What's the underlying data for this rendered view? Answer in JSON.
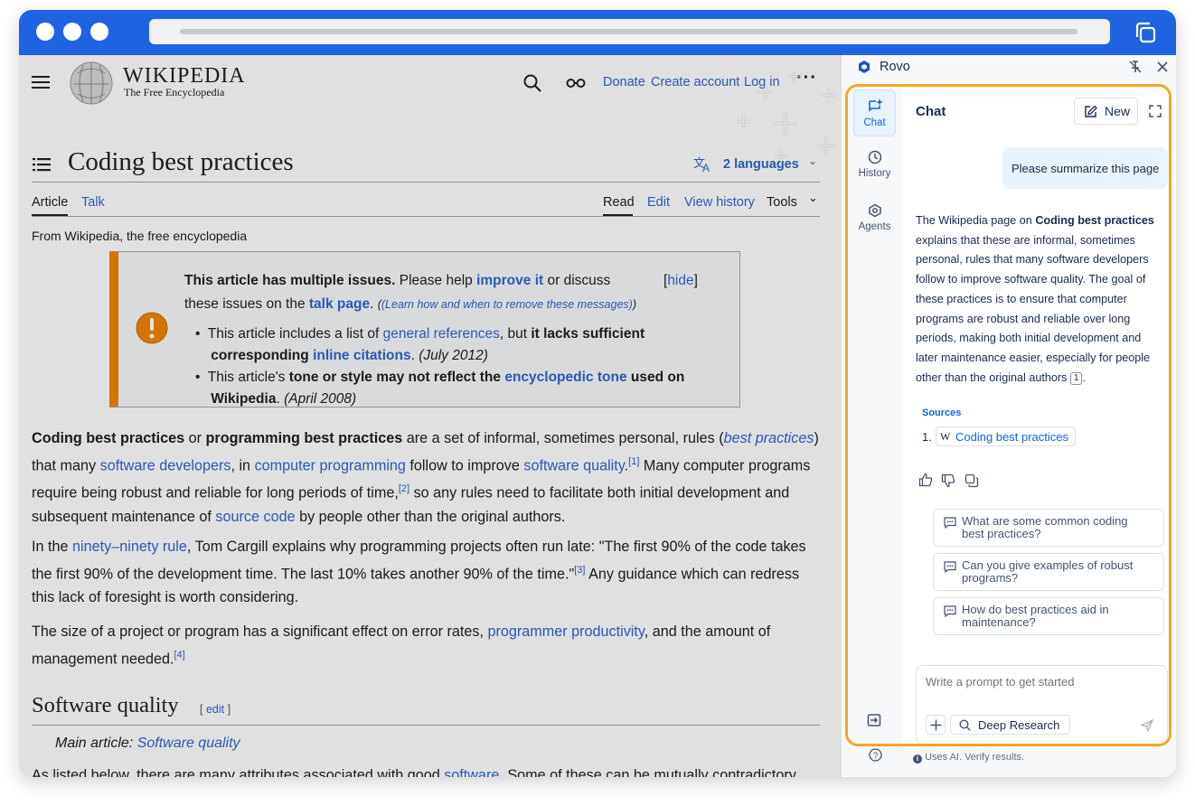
{
  "wiki": {
    "logo_title": "WIKIPEDIA",
    "logo_subtitle": "The Free Encyclopedia",
    "nav": {
      "donate": "Donate",
      "create_account": "Create account",
      "log_in": "Log in"
    },
    "page_title": "Coding best practices",
    "languages": "2 languages",
    "tabs": {
      "article": "Article",
      "talk": "Talk",
      "read": "Read",
      "edit": "Edit",
      "view_history": "View history",
      "tools": "Tools"
    },
    "tagline": "From Wikipedia, the free encyclopedia",
    "notice": {
      "hide": "hide",
      "line1_bold": "This article has multiple issues.",
      "line1_text": "Please help",
      "line1_link": "improve it",
      "line1_tail": "or discuss",
      "line2_text": "these issues on the",
      "line2_link": "talk page",
      "line2_small": "(Learn how and when to remove these messages)",
      "b1_text": "This article includes a list of",
      "b1_link": "general references",
      "b1_mid": ", but",
      "b1_bold": "it lacks sufficient",
      "b1_bold2": "corresponding",
      "b1_link2": "inline citations",
      "b1_date": "(July 2012)",
      "b2_text": "This article's",
      "b2_bold": "tone or style may not reflect the",
      "b2_link": "encyclopedic tone",
      "b2_bold2": "used on",
      "b2_bold3": "Wikipedia",
      "b2_date": "(April 2008)"
    },
    "p1": {
      "b1": "Coding best practices",
      "t1": "or",
      "b2": "programming best practices",
      "t2": "are a set of informal, sometimes personal, rules (",
      "l1": "best practices",
      "t3": ")",
      "t4": "that many",
      "l2": "software developers",
      "t5": ", in",
      "l3": "computer programming",
      "t6": "follow to improve",
      "l4": "software quality",
      "r1": "[1]",
      "t7": "Many computer programs",
      "t8": "require being robust and reliable for long periods of time,",
      "r2": "[2]",
      "t9": "so any rules need to facilitate both initial development and",
      "t10": "subsequent maintenance of",
      "l5": "source code",
      "t11": "by people other than the original authors."
    },
    "p2": {
      "t1": "In the",
      "l1": "ninety–ninety rule",
      "t2": ", Tom Cargill explains why programming projects often run late: \"The first 90% of the code takes",
      "t3": "the first 90% of the development time. The last 10% takes another 90% of the time.\"",
      "r1": "[3]",
      "t4": "Any guidance which can redress",
      "t5": "this lack of foresight is worth considering."
    },
    "p3": {
      "t1": "The size of a project or program has a significant effect on error rates,",
      "l1": "programmer productivity",
      "t2": ", and the amount of",
      "t3": "management needed.",
      "r1": "[4]"
    },
    "section": {
      "title": "Software quality",
      "edit": "edit",
      "main_label": "Main article:",
      "main_link": "Software quality"
    },
    "p4": {
      "t1": "As listed below, there are many attributes associated with good",
      "l1": "software",
      "t2": ". Some of these can be mutually contradictory"
    }
  },
  "rovo": {
    "title": "Rovo",
    "rail": {
      "chat": "Chat",
      "history": "History",
      "agents": "Agents"
    },
    "header": {
      "title": "Chat",
      "new_button": "New"
    },
    "user_message": "Please summarize this page",
    "answer": {
      "intro": "The Wikipedia page on",
      "bold": "Coding best practices",
      "lines": [
        "explains that these are informal, sometimes",
        "personal, rules that many software developers",
        "follow to improve software quality. The goal of",
        "these practices is to ensure that computer",
        "programs are robust and reliable over long",
        "periods, making both initial development and",
        "later maintenance easier, especially for people"
      ],
      "last_line": "other than the original authors",
      "citation": "1",
      "period": "."
    },
    "sources": {
      "label": "Sources",
      "index": "1.",
      "item": "Coding best practices"
    },
    "suggestions": [
      {
        "line1": "What are some common coding",
        "line2": "best practices?"
      },
      {
        "line1": "Can you give examples of robust",
        "line2": "programs?"
      },
      {
        "line1": "How do best practices aid in",
        "line2": "maintenance?"
      }
    ],
    "prompt_placeholder": "Write a prompt to get started",
    "deep_research": "Deep Research",
    "disclaimer": "Uses AI. Verify results."
  },
  "colors": {
    "browser_bar": "#1f63e3",
    "rovo_highlight": "#f5a623",
    "link": "#3366cc",
    "notice_bar": "#fc3"
  }
}
